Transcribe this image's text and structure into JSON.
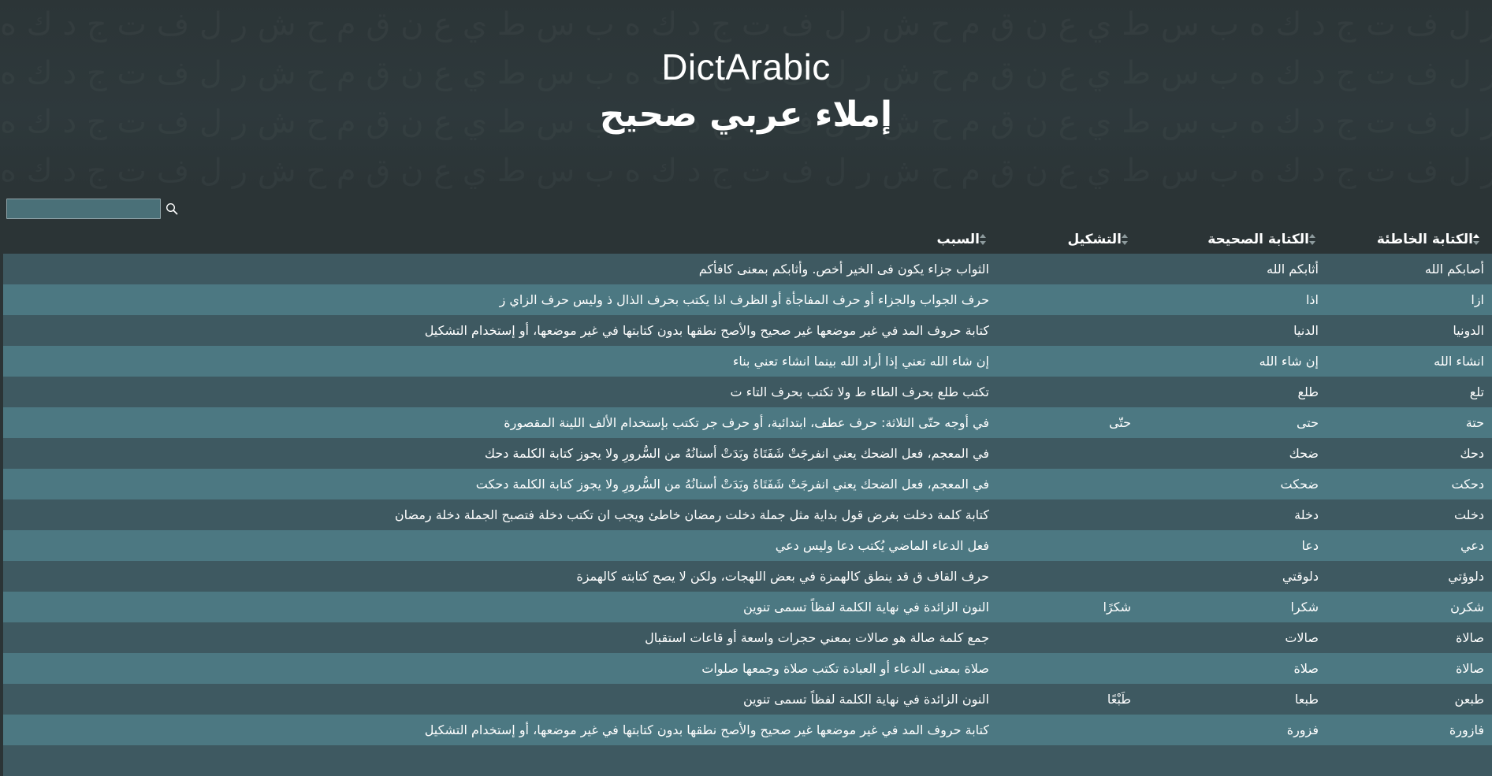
{
  "header": {
    "title_en": "DictArabic",
    "title_ar": "إملاء عربي صحيح",
    "background_glyphs": "ب س ط ي ع ن ق م ح ش ر ل ف ت ج د ك ه"
  },
  "search": {
    "value": "",
    "placeholder": "",
    "icon": "search-icon"
  },
  "table": {
    "columns": [
      "الكتابة الخاطئة",
      "الكتابة الصحيحة",
      "التشكيل",
      "السبب"
    ],
    "sorted_column": "الكتابة الخاطئة",
    "rows": [
      [
        "أصابكم الله",
        "أثابكم الله",
        "",
        "الثواب جزاء يكون فى الخير أخص. وأثابكم بمعنى كافأكم"
      ],
      [
        "ازا",
        "اذا",
        "",
        "حرف الجواب والجزاء أو حرف المفاجأة أو الظرف اذا يكتب بحرف الذال ذ وليس حرف الزاي ز"
      ],
      [
        "الدونيا",
        "الدنيا",
        "",
        "كتابة حروف المد في غير موضعها غير صحيح والأصح نطقها بدون كتابتها في غير موضعها، أو إستخدام التشكيل"
      ],
      [
        "انشاء الله",
        "إن شاء الله",
        "",
        "إن شاء الله تعني إذا أراد الله بينما انشاء تعني بناء"
      ],
      [
        "تلع",
        "طلع",
        "",
        "تكتب طلع بحرف الطاء ط ولا تكتب بحرف التاء ت"
      ],
      [
        "حتة",
        "حتى",
        "حتّى",
        "في أوجه حتّى الثلاثة: حرف عطف، ابتدائية، أو حرف جر تكتب بإستخدام الألف اللينة المقصورة"
      ],
      [
        "دحك",
        "ضحك",
        "",
        "في المعجم، فعل الضحك يعني انفرجَتْ شَفَتَاهُ وبَدَتْ أسنانُهُ من السُّرورِ ولا يجوز كتابة الكلمة دحك"
      ],
      [
        "دحكت",
        "ضحكت",
        "",
        "في المعجم، فعل الضحك يعني انفرجَتْ شَفَتَاهُ وبَدَتْ أسنانُهُ من السُّرورِ ولا يجوز كتابة الكلمة دحكت"
      ],
      [
        "دخلت",
        "دخلة",
        "",
        "كتابة كلمة دخلت بغرض قول بداية مثل جملة دخلت رمضان خاطئ ويجب ان تكتب دخلة فتصبح الجملة دخلة رمضان"
      ],
      [
        "دعي",
        "دعا",
        "",
        "فعل الدعاء الماضي يُكتب دعا وليس دعي"
      ],
      [
        "دلوؤتي",
        "دلوقتي",
        "",
        "حرف القاف ق قد ينطق كالهمزة في بعض اللهجات، ولكن لا يصح كتابته كالهمزة"
      ],
      [
        "شكرن",
        "شكرا",
        "شكرًا",
        "النون الزائدة في نهاية الكلمة لفظاً تسمى تنوين"
      ],
      [
        "صالاة",
        "صالات",
        "",
        "جمع كلمة صالة هو صالات بمعني حجرات واسعة أو قاعات استقبال"
      ],
      [
        "صالاة",
        "صلاة",
        "",
        "صلاة بمعنى الدعاء أو العبادة تكتب صلاة وجمعها صلوات"
      ],
      [
        "طبعن",
        "طبعا",
        "طَبْعًا",
        "النون الزائدة في نهاية الكلمة لفظاً تسمى تنوين"
      ],
      [
        "فازورة",
        "فزورة",
        "",
        "كتابة حروف المد في غير موضعها غير صحيح والأصح نطقها بدون كتابتها في غير موضعها، أو إستخدام التشكيل"
      ],
      [
        "",
        "",
        "",
        ""
      ]
    ]
  },
  "colors": {
    "page_bg": "#2b3436",
    "row_dark": "#3e5961",
    "row_light": "#4c7882",
    "search_bg": "#4a7078"
  }
}
